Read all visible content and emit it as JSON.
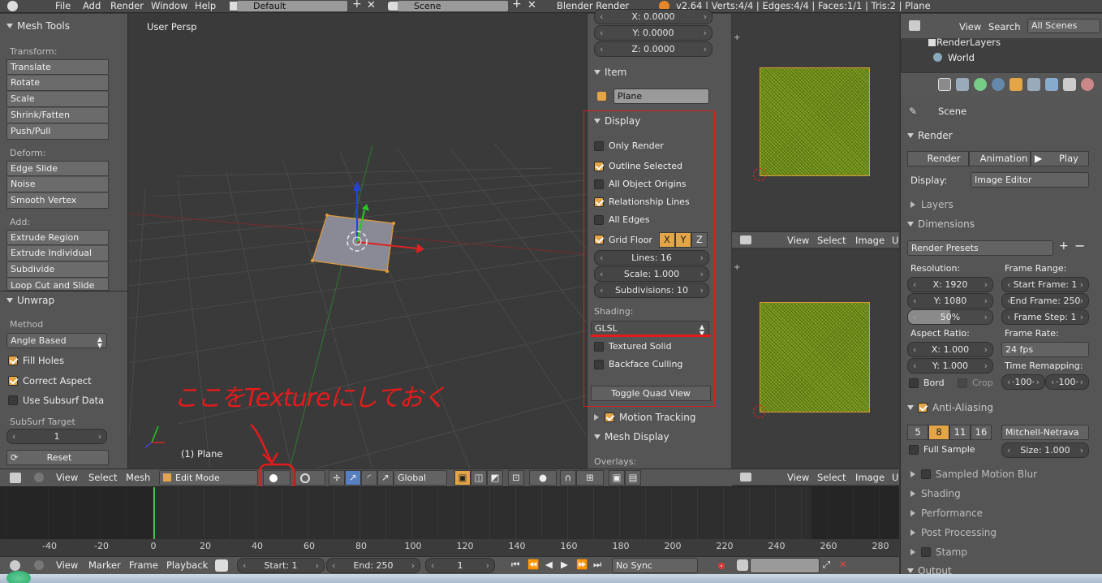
{
  "topbar": {
    "menus": [
      "File",
      "Add",
      "Render",
      "Window",
      "Help"
    ],
    "layout": "Default",
    "scene": "Scene",
    "engine": "Blender Render",
    "stats": "v2.64 | Verts:4/4 | Edges:4/4 | Faces:1/1 | Tris:2 | Plane"
  },
  "toolshelf": {
    "title": "Mesh Tools",
    "transform_label": "Transform:",
    "transform": [
      "Translate",
      "Rotate",
      "Scale",
      "Shrink/Fatten",
      "Push/Pull"
    ],
    "deform_label": "Deform:",
    "deform": [
      "Edge Slide",
      "Noise",
      "Smooth Vertex"
    ],
    "add_label": "Add:",
    "add": [
      "Extrude Region",
      "Extrude Individual",
      "Subdivide",
      "Loop Cut and Slide"
    ],
    "unwrap_title": "Unwrap",
    "method_label": "Method",
    "method_value": "Angle Based",
    "fill_holes": "Fill Holes",
    "correct_aspect": "Correct Aspect",
    "use_subsurf": "Use Subsurf Data",
    "subsurf_label": "SubSurf Target",
    "subsurf_value": "1",
    "reset": "Reset"
  },
  "viewport": {
    "view_name": "User Persp",
    "object_label": "(1) Plane",
    "annotation": "ここをTextureにしておく"
  },
  "npanel": {
    "loc_x": "X: 0.0000",
    "loc_y": "Y: 0.0000",
    "loc_z": "Z: 0.0000",
    "item_title": "Item",
    "object_name": "Plane",
    "display_title": "Display",
    "only_render": "Only Render",
    "outline_selected": "Outline Selected",
    "all_object_origins": "All Object Origins",
    "relationship_lines": "Relationship Lines",
    "all_edges": "All Edges",
    "grid_floor": "Grid Floor",
    "axis_x": "X",
    "axis_y": "Y",
    "axis_z": "Z",
    "lines": "Lines: 16",
    "scale": "Scale: 1.000",
    "subdivisions": "Subdivisions: 10",
    "shading_label": "Shading:",
    "shading_value": "GLSL",
    "textured_solid": "Textured Solid",
    "backface_culling": "Backface Culling",
    "toggle_quad": "Toggle Quad View",
    "motion_tracking": "Motion Tracking",
    "mesh_display": "Mesh Display",
    "overlays": "Overlays:"
  },
  "uv_header": {
    "view": "View",
    "select": "Select",
    "image": "Image",
    "u": "U"
  },
  "outliner": {
    "view": "View",
    "search": "Search",
    "scenes": "All Scenes",
    "render_layers": "RenderLayers",
    "world": "World"
  },
  "props": {
    "scene": "Scene",
    "render_title": "Render",
    "render_btn": "Render",
    "animation_btn": "Animation",
    "play_btn": "Play",
    "display_label": "Display:",
    "display_value": "Image Editor",
    "layers": "Layers",
    "dimensions": "Dimensions",
    "render_presets": "Render Presets",
    "resolution_label": "Resolution:",
    "res_x": "X: 1920",
    "res_y": "Y: 1080",
    "res_pct": "50%",
    "frame_range_label": "Frame Range:",
    "start_frame": "Start Frame: 1",
    "end_frame": "End Frame: 250",
    "frame_step": "Frame Step: 1",
    "aspect_label": "Aspect Ratio:",
    "asp_x": "X: 1.000",
    "asp_y": "Y: 1.000",
    "frame_rate_label": "Frame Rate:",
    "frame_rate": "24 fps",
    "bord": "Bord",
    "crop": "Crop",
    "time_remap": "Time Remapping:",
    "remap_old": "·100·",
    "remap_new": "·100·",
    "anti_aliasing": "Anti-Aliasing",
    "aa_5": "5",
    "aa_8": "8",
    "aa_11": "11",
    "aa_16": "16",
    "filter": "Mitchell-Netrava",
    "full_sample": "Full Sample",
    "size": "Size: 1.000",
    "sampled_motion_blur": "Sampled Motion Blur",
    "shading": "Shading",
    "performance": "Performance",
    "post_processing": "Post Processing",
    "stamp": "Stamp",
    "output": "Output"
  },
  "vp_header": {
    "view": "View",
    "select": "Select",
    "mesh": "Mesh",
    "mode": "Edit Mode",
    "orientation": "Global"
  },
  "timeline": {
    "ticks": [
      "-40",
      "-20",
      "0",
      "20",
      "40",
      "60",
      "80",
      "100",
      "120",
      "140",
      "160",
      "180",
      "200",
      "220",
      "240",
      "260",
      "280"
    ]
  },
  "tl_header": {
    "view": "View",
    "marker": "Marker",
    "frame": "Frame",
    "playback": "Playback",
    "start": "Start: 1",
    "end": "End: 250",
    "current": "1",
    "sync": "No Sync"
  }
}
